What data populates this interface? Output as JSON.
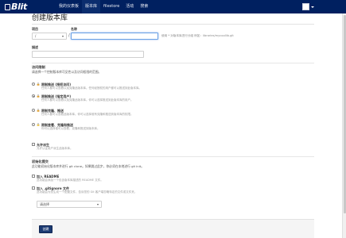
{
  "brand": {
    "logo_text": "Blit"
  },
  "nav": {
    "items": [
      {
        "label": "我的仪表板",
        "active": false
      },
      {
        "label": "版本库",
        "active": true
      },
      {
        "label": "filestore",
        "active": false
      },
      {
        "label": "活动",
        "active": false
      },
      {
        "label": "搜索",
        "active": false
      }
    ]
  },
  "page": {
    "title": "创建版本库"
  },
  "form": {
    "project_label": "项目",
    "project_value": "/",
    "name_label": "名称",
    "name_value": "",
    "name_help": "使用 * 对版本库进行分组 例如：libraries/mycoollib.git",
    "slash": "/",
    "description_label": "描述",
    "description_value": ""
  },
  "access": {
    "title": "访问限制",
    "desc": "请选择一个控制版本库可见性以及访问权限的范围。",
    "options": [
      {
        "title": "限制推送 (授权访问)",
        "desc": "任何人都可以查看以及克隆此版本库。任何经授权的用户都可以推送到此版本库。",
        "icon_color": "#e0a030",
        "selected": false
      },
      {
        "title": "限制推送 (指定用户)",
        "desc": "任何人都可以查看以及克隆此版本库。你可以选择推送到此版本库的用户。",
        "icon_color": "#e0a030",
        "selected": true
      },
      {
        "title": "限制克隆、推送",
        "desc": "任何人都可以查看此版本库。你可以选择谁有克隆和推送到版本库的权限。",
        "icon_color": "#e0a030",
        "selected": false
      },
      {
        "title": "限制查看、克隆和推送",
        "desc": "你可以选择谁可以查看，克隆和推送到版本库。",
        "icon_color": "#e8c040",
        "selected": false
      }
    ]
  },
  "forks": {
    "title": "允许派生",
    "desc": "允许认证用户派生此版本库。",
    "checked": false
  },
  "init": {
    "title": "初始化提交",
    "desc": "此功能初始化版本库并进行 git clone。如果跳过此步，你必须在本地进行 git init。",
    "readme_title": "加入 README",
    "readme_desc": "此功能会添加一个包含版本库描述的 README 文件。",
    "gitignore_title": "加入 .gitignore 文件",
    "gitignore_desc": "此功能会为您生成一个配置文件，告诉您的 Git 客户端忽略特定的文件或文件夹。",
    "gitignore_select": "请选择"
  },
  "actions": {
    "create_label": "创建"
  }
}
